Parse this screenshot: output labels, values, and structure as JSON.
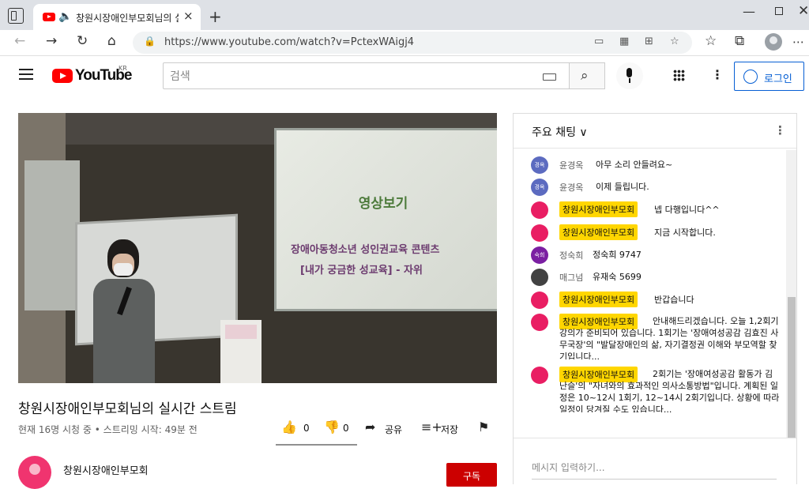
{
  "browser": {
    "tab_title": "창원시장애인부모회님의 실",
    "url": "https://www.youtube.com/watch?v=PctexWAigj4"
  },
  "youtube": {
    "wordmark": "YouTube",
    "country": "KR",
    "search_placeholder": "검색",
    "login_label": "로그인"
  },
  "video": {
    "slide_title": "영상보기",
    "slide_line1": "장애아동청소년 성인권교육 콘텐츠",
    "slide_line2": "[내가 궁금한 성교육] - 자위",
    "title": "창원시장애인부모회님의 실시간 스트림",
    "meta": "현재 16명 시청 중 • 스트리밍 시작: 49분 전",
    "likes": "0",
    "dislikes": "0",
    "share_label": "공유",
    "save_label": "저장",
    "channel_name": "창원시장애인부모회",
    "subscribe_label": "구독"
  },
  "chat": {
    "mode_label": "주요 채팅 ∨",
    "input_placeholder": "메시지 입력하기...",
    "messages": [
      {
        "author": "윤경옥",
        "avatar": "경옥",
        "color": "#5c6bc0",
        "text": "아무 소리 안들려요~"
      },
      {
        "author": "윤경옥",
        "avatar": "경옥",
        "color": "#5c6bc0",
        "text": "이제 들립니다."
      },
      {
        "author": "창원시장애인부모회",
        "color": "#e91e63",
        "text": "넵 다행입니다^^"
      },
      {
        "author": "창원시장애인부모회",
        "color": "#e91e63",
        "text": "지금 시작합니다."
      },
      {
        "author": "정숙희",
        "avatar": "숙희",
        "color": "#7b1fa2",
        "text": "정숙희 9747"
      },
      {
        "author": "매그넘",
        "color": "#424242",
        "text": "유재숙 5699"
      },
      {
        "author": "창원시장애인부모회",
        "color": "#e91e63",
        "text": "반갑습니다"
      },
      {
        "author": "창원시장애인부모회",
        "color": "#e91e63",
        "text": "안내해드리겠습니다. 오늘 1,2회기 강의가 준비되어 있습니다. 1회기는 '장애여성공감 김효진 사무국장'의 \"발달장애인의 삶, 자기결정권 이해와 부모역할 찾기입니다..."
      },
      {
        "author": "창원시장애인부모회",
        "color": "#e91e63",
        "text": "2회기는 '장애여성공감 활동가 김난슬'의 \"자녀와의 효과적인 의사소통방법\"입니다. 계획된 일정은 10~12시 1회기, 12~14시 2회기입니다. 상황에 따라 일정이 당겨질 수도 있습니다..."
      }
    ]
  }
}
